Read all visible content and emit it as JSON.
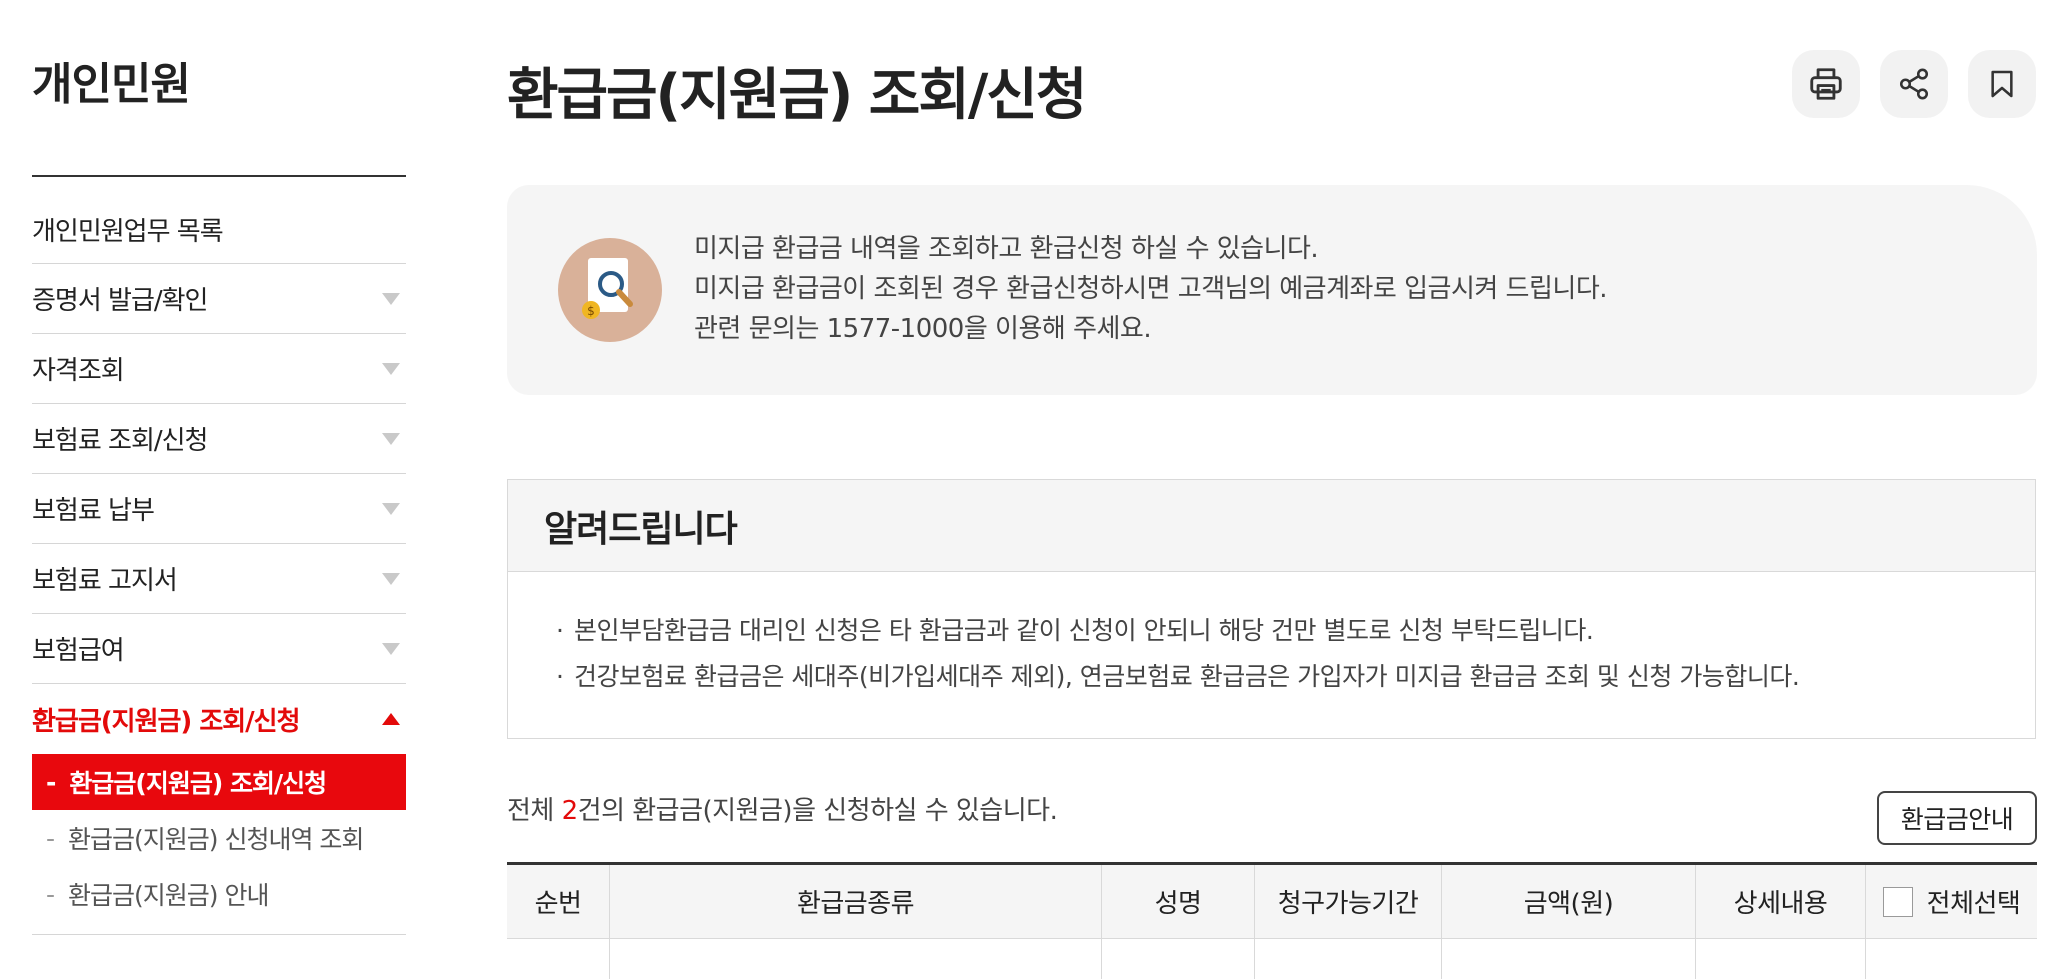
{
  "sidebar": {
    "title": "개인민원",
    "items": [
      {
        "label": "개인민원업무 목록"
      },
      {
        "label": "증명서 발급/확인"
      },
      {
        "label": "자격조회"
      },
      {
        "label": "보험료 조회/신청"
      },
      {
        "label": "보험료 납부"
      },
      {
        "label": "보험료 고지서"
      },
      {
        "label": "보험급여"
      },
      {
        "label": "환급금(지원금) 조회/신청"
      }
    ],
    "sub_items": [
      {
        "label": "환급금(지원금) 조회/신청"
      },
      {
        "label": "환급금(지원금) 신청내역 조회"
      },
      {
        "label": "환급금(지원금) 안내"
      }
    ],
    "dash": "-"
  },
  "header": {
    "title": "환급금(지원금) 조회/신청"
  },
  "intro": {
    "lines": [
      "미지급 환급금 내역을 조회하고 환급신청 하실 수 있습니다.",
      "미지급 환급금이 조회된 경우 환급신청하시면 고객님의 예금계좌로 입금시켜 드립니다.",
      "관련 문의는 1577-1000을 이용해 주세요."
    ]
  },
  "notice": {
    "title": "알려드립니다",
    "items": [
      "본인부담환급금 대리인 신청은 타 환급금과 같이 신청이 안되니 해당 건만 별도로 신청 부탁드립니다.",
      "건강보험료 환급금은 세대주(비가입세대주 제외), 연금보험료 환급금은 가입자가 미지급 환급금 조회 및 신청 가능합니다."
    ]
  },
  "summary": {
    "prefix": "전체 ",
    "count": "2",
    "suffix": "건의 환급금(지원금)을 신청하실 수 있습니다.",
    "guide_button": "환급금안내"
  },
  "table": {
    "headers": [
      "순번",
      "환급금종류",
      "성명",
      "청구가능기간",
      "금액(원)",
      "상세내용"
    ],
    "select_all": "전체선택"
  },
  "colors": {
    "accent": "#e30a0a",
    "panel_bg": "#f5f5f5"
  },
  "icons": {
    "print": "print-icon",
    "share": "share-icon",
    "bookmark": "bookmark-icon",
    "intro": "document-search-icon"
  }
}
